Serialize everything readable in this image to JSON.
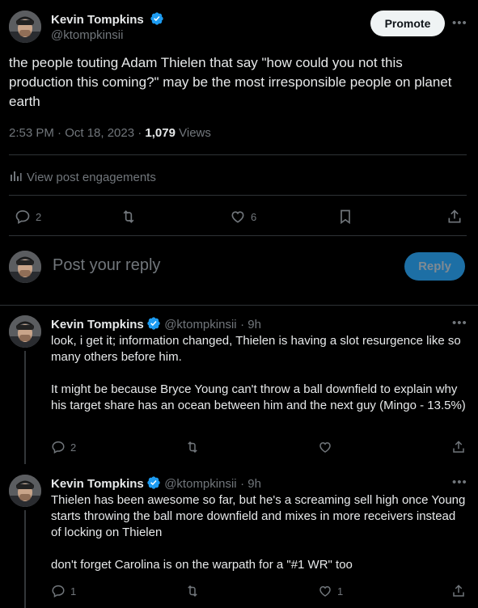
{
  "tweet": {
    "author_name": "Kevin Tompkins",
    "author_handle": "@ktompkinsii",
    "promote_label": "Promote",
    "text": "the people touting Adam Thielen that say \"how could you not this production this coming?\" may be the most irresponsible people on planet earth",
    "time": "2:53 PM · Oct 18, 2023 · ",
    "views_count": "1,079",
    "views_label": " Views",
    "engagements_label": "View post engagements",
    "replies": "2",
    "likes": "6"
  },
  "composer": {
    "placeholder": "Post your reply",
    "reply_label": "Reply"
  },
  "replies": [
    {
      "author_name": "Kevin Tompkins",
      "author_handle": "@ktompkinsii",
      "age": "· 9h",
      "text": "look, i get it; information changed, Thielen is having a slot resurgence like so many others before him.\n\nIt might be because Bryce Young can't throw a ball downfield to explain why his target share has an ocean between him and the next guy (Mingo - 13.5%)",
      "replies": "2",
      "likes": ""
    },
    {
      "author_name": "Kevin Tompkins",
      "author_handle": "@ktompkinsii",
      "age": "· 9h",
      "text": "Thielen has been awesome so far, but he's a screaming sell high once Young starts throwing the ball more downfield and mixes in more receivers instead of locking on Thielen\n\ndon't forget Carolina is on the warpath for a \"#1 WR\" too",
      "replies": "1",
      "likes": "1"
    }
  ],
  "colors": {
    "background": "#000000",
    "text": "#e7e9ea",
    "muted": "#71767b",
    "divider": "#2f3336",
    "verified": "#1d9bf0",
    "reply_button": "#1d6fa5"
  }
}
